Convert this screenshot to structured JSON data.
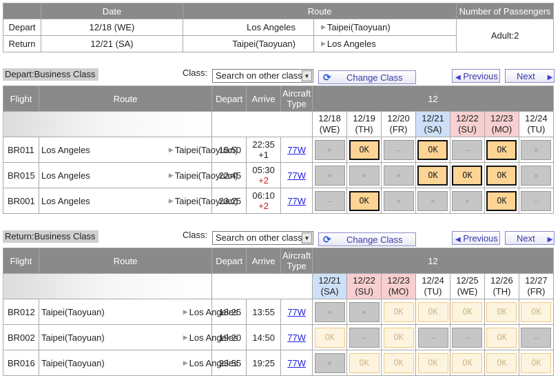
{
  "summary": {
    "headers": [
      "",
      "Date",
      "Route",
      "Number of Passengers"
    ],
    "rows": [
      {
        "label": "Depart",
        "date": "12/18 (WE)",
        "from": "Los Angeles",
        "to": "Taipei(Taoyuan)"
      },
      {
        "label": "Return",
        "date": "12/21 (SA)",
        "from": "Taipei(Taoyuan)",
        "to": "Los Angeles"
      }
    ],
    "passengers": "Adult:2"
  },
  "sections": [
    {
      "title": "Depart:Business Class",
      "class_label": "Class:",
      "class_select": "Search on other class",
      "change_class": "Change Class",
      "previous": "Previous",
      "next": "Next",
      "headers": {
        "flight": "Flight",
        "route": "Route",
        "depart": "Depart",
        "arrive": "Arrive",
        "aircraft": "Aircraft Type",
        "month": "12"
      },
      "days": [
        {
          "date": "12/18",
          "dow": "(WE)",
          "type": ""
        },
        {
          "date": "12/19",
          "dow": "(TH)",
          "type": ""
        },
        {
          "date": "12/20",
          "dow": "(FR)",
          "type": ""
        },
        {
          "date": "12/21",
          "dow": "(SA)",
          "type": "sat"
        },
        {
          "date": "12/22",
          "dow": "(SU)",
          "type": "hol"
        },
        {
          "date": "12/23",
          "dow": "(MO)",
          "type": "hol"
        },
        {
          "date": "12/24",
          "dow": "(TU)",
          "type": ""
        }
      ],
      "flights": [
        {
          "flight": "BR011",
          "from": "Los Angeles",
          "to": "Taipei(Taoyuan)",
          "depart": "15:50",
          "arrive": "22:35",
          "plus": "+1",
          "plus_red": false,
          "aircraft": "77W",
          "avail": [
            "x",
            "OK",
            "-",
            "OK",
            "-",
            "OK",
            "x"
          ]
        },
        {
          "flight": "BR015",
          "from": "Los Angeles",
          "to": "Taipei(Taoyuan)",
          "depart": "22:45",
          "arrive": "05:30",
          "plus": "+2",
          "plus_red": true,
          "aircraft": "77W",
          "avail": [
            "x",
            "x",
            "x",
            "OK",
            "OK",
            "OK",
            "x"
          ]
        },
        {
          "flight": "BR001",
          "from": "Los Angeles",
          "to": "Taipei(Taoyuan)",
          "depart": "23:25",
          "arrive": "06:10",
          "plus": "+2",
          "plus_red": true,
          "aircraft": "77W",
          "avail": [
            "-",
            "OK",
            "x",
            "x",
            "x",
            "OK",
            "-"
          ]
        }
      ],
      "ok_style": "selectable"
    },
    {
      "title": "Return:Business Class",
      "class_label": "Class:",
      "class_select": "Search on other class",
      "change_class": "Change Class",
      "previous": "Previous",
      "next": "Next",
      "headers": {
        "flight": "Flight",
        "route": "Route",
        "depart": "Depart",
        "arrive": "Arrive",
        "aircraft": "Aircraft Type",
        "month": "12"
      },
      "days": [
        {
          "date": "12/21",
          "dow": "(SA)",
          "type": "sat"
        },
        {
          "date": "12/22",
          "dow": "(SU)",
          "type": "hol"
        },
        {
          "date": "12/23",
          "dow": "(MO)",
          "type": "hol"
        },
        {
          "date": "12/24",
          "dow": "(TU)",
          "type": ""
        },
        {
          "date": "12/25",
          "dow": "(WE)",
          "type": ""
        },
        {
          "date": "12/26",
          "dow": "(TH)",
          "type": ""
        },
        {
          "date": "12/27",
          "dow": "(FR)",
          "type": ""
        }
      ],
      "flights": [
        {
          "flight": "BR012",
          "from": "Taipei(Taoyuan)",
          "to": "Los Angeles",
          "depart": "18:25",
          "arrive": "13:55",
          "plus": "",
          "plus_red": false,
          "aircraft": "77W",
          "avail": [
            "x",
            "x",
            "OK",
            "OK",
            "OK",
            "OK",
            "OK"
          ]
        },
        {
          "flight": "BR002",
          "from": "Taipei(Taoyuan)",
          "to": "Los Angeles",
          "depart": "19:20",
          "arrive": "14:50",
          "plus": "",
          "plus_red": false,
          "aircraft": "77W",
          "avail": [
            "OK",
            "-",
            "OK",
            "-",
            "-",
            "OK",
            "-"
          ]
        },
        {
          "flight": "BR016",
          "from": "Taipei(Taoyuan)",
          "to": "Los Angeles",
          "depart": "23:55",
          "arrive": "19:25",
          "plus": "",
          "plus_red": false,
          "aircraft": "77W",
          "avail": [
            "x",
            "OK",
            "OK",
            "OK",
            "OK",
            "OK",
            "OK"
          ]
        }
      ],
      "ok_style": "pale"
    }
  ],
  "symbols": {
    "x": "×",
    "-": "–",
    "OK": "OK"
  }
}
